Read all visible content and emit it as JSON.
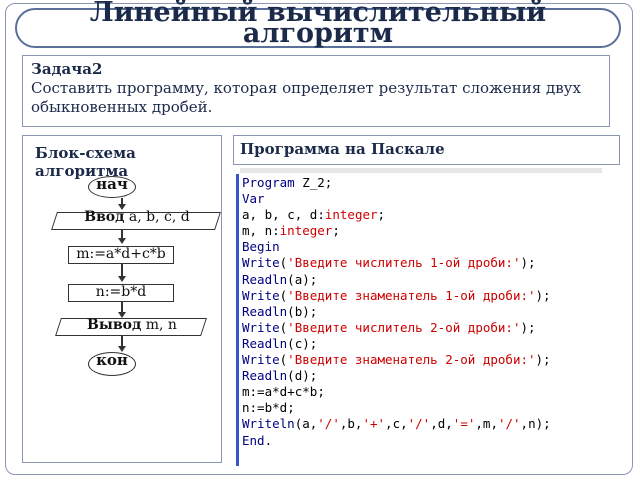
{
  "title": "Линейный вычислительный алгоритм",
  "task": {
    "heading": "Задача2",
    "text": "Составить программу, которая определяет результат сложения двух обыкновенных дробей."
  },
  "left_panel": {
    "title": "Блок-схема алгоритма",
    "flowchart": {
      "start": "нач",
      "input_keyword": "Ввод",
      "input_vars": " a, b, c, d",
      "calc1": "m:=a*d+c*b",
      "calc2": "n:=b*d",
      "output_keyword": "Вывод",
      "output_vars": " m, n",
      "end": "кон"
    }
  },
  "right_panel": {
    "title": "Программа на Паскале",
    "code_lines": [
      "Program Z_2;",
      "Var",
      "a, b, c, d:integer;",
      "m, n:integer;",
      "Begin",
      "Write('Введите числитель 1-ой дроби:');",
      "Readln(a);",
      "Write('Введите знаменатель 1-ой дроби:');",
      "Readln(b);",
      "Write('Введите числитель 2-ой дроби:');",
      "Readln(c);",
      "Write('Введите знаменатель 2-ой дроби:');",
      "Readln(d);",
      "m:=a*d+c*b;",
      "n:=b*d;",
      "Writeln(a,'/',b,'+',c,'/',d,'=',m,'/',n);",
      "End."
    ]
  },
  "colors": {
    "border": "#8a96b3",
    "title_text": "#1c2a4a",
    "keyword": "#000080",
    "string": "#cc0000",
    "editor_bar": "#3a55c8"
  }
}
